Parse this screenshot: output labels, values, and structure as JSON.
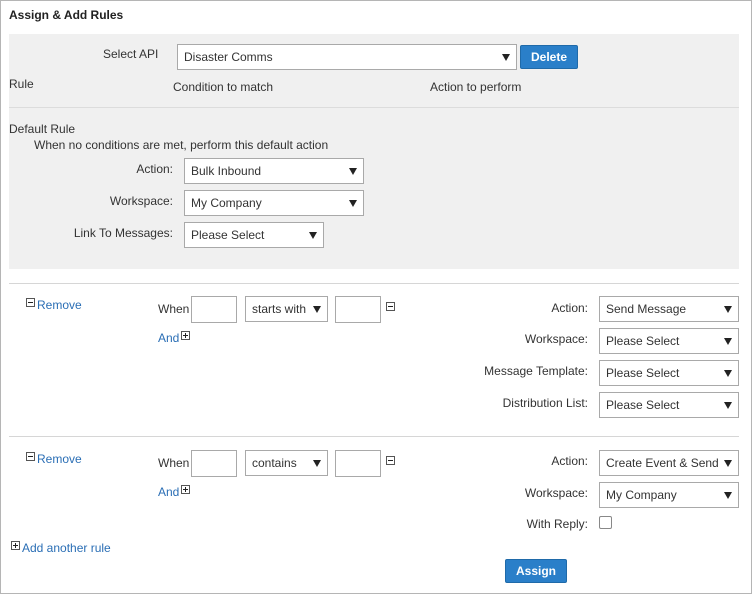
{
  "title": "Assign & Add Rules",
  "api": {
    "label": "Select API",
    "value": "Disaster Comms",
    "delete_label": "Delete"
  },
  "headers": {
    "rule": "Rule",
    "condition": "Condition to match",
    "action": "Action to perform"
  },
  "default_rule": {
    "heading": "Default Rule",
    "description": "When no conditions are met, perform this default action",
    "action_label": "Action:",
    "action_value": "Bulk Inbound",
    "workspace_label": "Workspace:",
    "workspace_value": "My Company",
    "link_label": "Link To Messages:",
    "link_value": "Please Select"
  },
  "rules": [
    {
      "remove_label": "Remove",
      "when_label": "When",
      "operator": "starts with",
      "and_label": "And",
      "action_label": "Action:",
      "action_value": "Send Message",
      "workspace_label": "Workspace:",
      "workspace_value": "Please Select",
      "template_label": "Message Template:",
      "template_value": "Please Select",
      "distribution_label": "Distribution List:",
      "distribution_value": "Please Select"
    },
    {
      "remove_label": "Remove",
      "when_label": "When",
      "operator": "contains",
      "and_label": "And",
      "action_label": "Action:",
      "action_value": "Create Event & Send",
      "workspace_label": "Workspace:",
      "workspace_value": "My Company",
      "reply_label": "With Reply:",
      "reply_checked": false
    }
  ],
  "add_rule_label": "Add another rule",
  "assign_label": "Assign"
}
